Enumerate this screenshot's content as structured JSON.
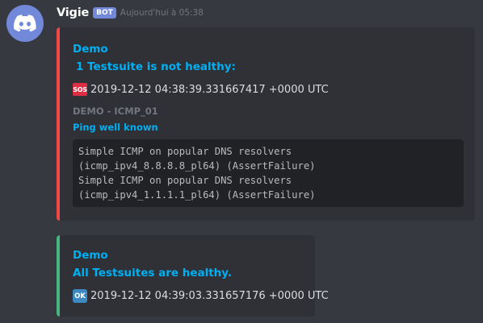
{
  "message": {
    "username": "Vigie",
    "bot_tag": "BOT",
    "timestamp": "Aujourd'hui à 05:38"
  },
  "embeds": [
    {
      "accent_color": "#f04747",
      "title": "Demo",
      "subtitle": "1 Testsuite is not healthy:",
      "status_emoji": "SOS",
      "status_time": "2019-12-12 04:38:39.331667417 +0000 UTC",
      "field_name": "DEMO - ICMP_01",
      "field_subtitle": "Ping well known",
      "code_lines": [
        "Simple ICMP on popular DNS resolvers",
        "(icmp_ipv4_8.8.8.8_pl64) (AssertFailure)",
        "Simple ICMP on popular DNS resolvers",
        "(icmp_ipv4_1.1.1.1_pl64) (AssertFailure)"
      ]
    },
    {
      "accent_color": "#43b581",
      "title": "Demo",
      "subtitle": "All Testsuites are healthy.",
      "status_emoji": "OK",
      "status_time": "2019-12-12 04:39:03.331657176 +0000 UTC"
    }
  ],
  "icons": {
    "avatar": "discord-logo-icon",
    "sos": "sos-emoji-icon",
    "ok": "ok-emoji-icon"
  }
}
